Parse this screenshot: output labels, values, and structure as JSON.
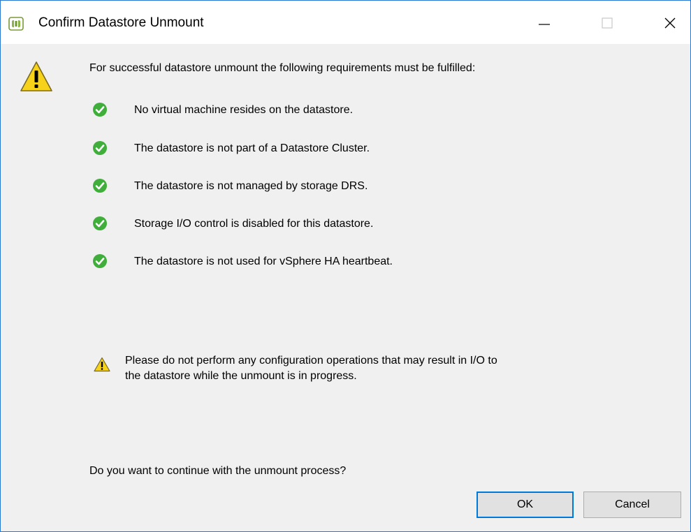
{
  "window": {
    "title": "Confirm Datastore Unmount",
    "controls": {
      "minimize": "minimize-icon",
      "maximize": "maximize-icon",
      "close": "close-icon"
    }
  },
  "dialog": {
    "intro": "For successful datastore unmount the following requirements must be fulfilled:",
    "requirements": [
      {
        "label": "No virtual machine resides on the datastore.",
        "icon": "check-icon"
      },
      {
        "label": "The datastore is not part of a Datastore Cluster.",
        "icon": "check-icon"
      },
      {
        "label": "The datastore is not managed by storage DRS.",
        "icon": "check-icon"
      },
      {
        "label": "Storage I/O control is disabled for this datastore.",
        "icon": "check-icon"
      },
      {
        "label": "The datastore is not used for vSphere HA heartbeat.",
        "icon": "check-icon"
      }
    ],
    "caution": {
      "line1": "Please do not perform any configuration operations that may result in I/O to",
      "line2": "the datastore while the unmount is in progress.",
      "icon": "warning-icon"
    },
    "question": "Do you want to continue with the unmount process?",
    "buttons": {
      "ok": "OK",
      "cancel": "Cancel"
    }
  },
  "colors": {
    "accent": "#0078d7",
    "check_green": "#3fae3a",
    "warning_yellow": "#f7d21b",
    "border": "#2b78d0"
  }
}
